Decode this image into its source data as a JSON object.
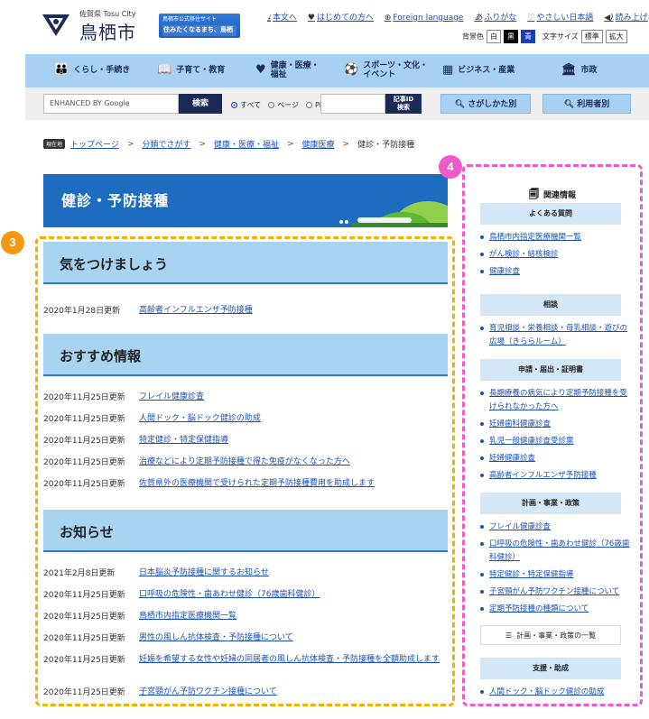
{
  "header": {
    "pref_city": "佐賀県 Tosu City",
    "city_name": "鳥栖市",
    "banner_top": "鳥栖市公式移住サイト",
    "banner_main": "住みたくなるまち、鳥栖",
    "links": [
      {
        "icon": "download-icon",
        "label": "本文へ"
      },
      {
        "icon": "beginner-icon",
        "label": "はじめての方へ"
      },
      {
        "icon": "globe-icon",
        "label": "Foreign language"
      },
      {
        "icon": "furigana-icon",
        "label": "ふりがな"
      },
      {
        "icon": "easy-japanese-icon",
        "label": "やさしい日本語"
      },
      {
        "icon": "speaker-icon",
        "label": "読み上げ"
      }
    ],
    "bgcolor_label": "背景色",
    "bg_white": "白",
    "bg_black": "黒",
    "bg_blue": "青",
    "fontsize_label": "文字サイズ",
    "font_standard": "標準",
    "font_large": "拡大"
  },
  "nav": [
    {
      "icon": "family-icon",
      "label": "くらし・手続き"
    },
    {
      "icon": "book-icon",
      "label": "子育て・教育"
    },
    {
      "icon": "heart-icon",
      "label": "健康・医療・\n福祉"
    },
    {
      "icon": "sports-icon",
      "label": "スポーツ・文化・\nイベント"
    },
    {
      "icon": "business-icon",
      "label": "ビジネス・産業"
    },
    {
      "icon": "building-icon",
      "label": "市政"
    }
  ],
  "search": {
    "google_placeholder": "ENHANCED BY Google",
    "search_button": "検索",
    "radio_all": "すべて",
    "radio_page": "ページ",
    "radio_pdf": "PDF",
    "id_button": "記事ID\n検索",
    "find_by_category": "さがしかた別",
    "find_by_user": "利用者別"
  },
  "breadcrumb": {
    "here": "現在地",
    "items": [
      "トップページ",
      "分類でさがす",
      "健康・医療・福祉",
      "健康医療"
    ],
    "current": "健診・予防接種"
  },
  "page_title": "健診・予防接種",
  "sections": [
    {
      "title": "気をつけましょう",
      "items": [
        {
          "date": "2020年1月28日更新",
          "title": "高齢者インフルエンザ予防接種"
        }
      ]
    },
    {
      "title": "おすすめ情報",
      "items": [
        {
          "date": "2020年11月25日更新",
          "title": "フレイル健康診査"
        },
        {
          "date": "2020年11月25日更新",
          "title": "人間ドック・脳ドック健診の助成"
        },
        {
          "date": "2020年11月25日更新",
          "title": "特定健診・特定保健指導"
        },
        {
          "date": "2020年11月25日更新",
          "title": "治療などにより定期予防接種で得た免疫がなくなった方へ"
        },
        {
          "date": "2020年11月25日更新",
          "title": "佐賀県外の医療機関で受けられた定期予防接種費用を助成します"
        }
      ]
    },
    {
      "title": "お知らせ",
      "items": [
        {
          "date": "2021年2月8日更新",
          "title": "日本脳炎予防接種に関するお知らせ"
        },
        {
          "date": "2020年11月25日更新",
          "title": "口呼吸の危険性・歯あわせ健診（76歳歯科健診）"
        },
        {
          "date": "2020年11月25日更新",
          "title": "鳥栖市内指定医療機関一覧"
        },
        {
          "date": "2020年11月25日更新",
          "title": "男性の風しん抗体検査・予防接種について"
        },
        {
          "date": "2020年11月25日更新",
          "title": "妊娠を希望する女性や妊婦の同居者の風しん抗体検査・予防接種を全額助成します"
        },
        {
          "date": "2020年11月25日更新",
          "title": "子宮頸がん予防ワクチン接種について"
        }
      ]
    }
  ],
  "sidebar": {
    "heading": "関連情報",
    "categories": [
      {
        "title": "よくある質問",
        "items": [
          "鳥栖市内指定医療機関一覧",
          "がん検診・結核検診",
          "健康診査"
        ]
      },
      {
        "title": "相談",
        "items": [
          "育児相談・栄養相談・母乳相談・遊びの広場（きららルーム）"
        ]
      },
      {
        "title": "申請・届出・証明書",
        "items": [
          "長期療養の病気により定期予防接種を受けられなかった方へ",
          "妊婦歯科健康診査",
          "乳児一般健康診査受診票",
          "妊婦健康診査",
          "高齢者インフルエンザ予防接種"
        ]
      },
      {
        "title": "計画・事業・政策",
        "items": [
          "フレイル健康診査",
          "口呼吸の危険性・歯あわせ健診（76歳歯科健診）",
          "特定健診・特定保健指導",
          "子宮頸がん予防ワクチン接種について",
          "定期予防接種の種類について"
        ],
        "more": "計画・事業・政策の一覧"
      },
      {
        "title": "支援・助成",
        "items": [
          "人間ドック・脳ドック健診の助成"
        ]
      }
    ]
  },
  "annotations": {
    "box3": "3",
    "box4": "4"
  },
  "colors": {
    "nav_bg": "#a8d0f2",
    "title_bg": "#1e6cc0",
    "section_bg": "#a8d4f2",
    "link": "#1a4fb8",
    "annot3": "#f3b000",
    "annot4": "#ee5bc9"
  }
}
